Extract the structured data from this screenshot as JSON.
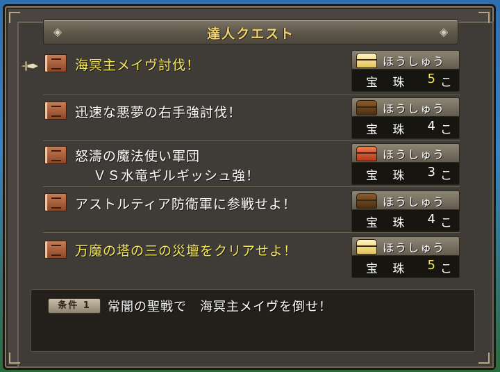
{
  "title": "達人クエスト",
  "reward_label": "ほうしゅう",
  "quests": [
    {
      "name": "海冥主メイヴ討伐！",
      "line2": "",
      "highlight": true,
      "item": "宝 珠",
      "count": "5",
      "unit": "こ",
      "chest": "gold"
    },
    {
      "name": "迅速な悪夢の右手強討伐！",
      "line2": "",
      "highlight": false,
      "item": "宝 珠",
      "count": "4",
      "unit": "こ",
      "chest": "brown"
    },
    {
      "name": "怒濤の魔法使い軍団",
      "line2": "ＶＳ水竜ギルギッシュ強！",
      "highlight": false,
      "item": "宝 珠",
      "count": "3",
      "unit": "こ",
      "chest": "red"
    },
    {
      "name": "アストルティア防衛軍に参戦せよ！",
      "line2": "",
      "highlight": false,
      "item": "宝 珠",
      "count": "4",
      "unit": "こ",
      "chest": "brown"
    },
    {
      "name": "万魔の塔の三の災壇をクリアせよ！",
      "line2": "",
      "highlight": true,
      "item": "宝 珠",
      "count": "5",
      "unit": "こ",
      "chest": "gold"
    }
  ],
  "condition": {
    "badge": "条件 1",
    "text": "常闇の聖戦で　海冥主メイヴを倒せ！"
  }
}
